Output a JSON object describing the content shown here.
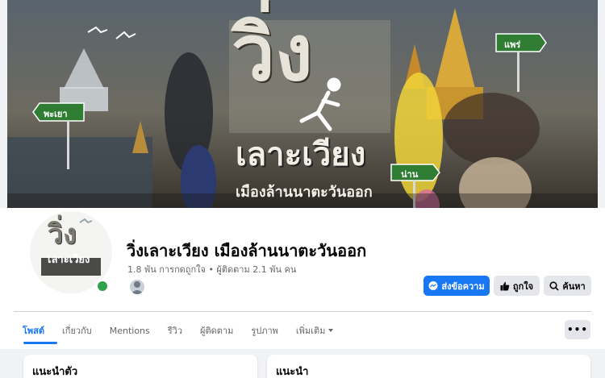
{
  "page": {
    "name": "วิ่งเลาะเวียง เมืองล้านนาตะวันออก",
    "stats": "1.8 พัน การกดถูกใจ • ผู้ติดตาม 2.1 พัน คน"
  },
  "cover": {
    "title_big": "วิ่ง",
    "title_line2": "เลาะเวียง",
    "title_line3": "เมืองล้านนาตะวันออก",
    "sign_left": "พะเยา",
    "sign_right_top": "แพร่",
    "sign_right_bottom": "น่าน"
  },
  "avatar": {
    "logo_line1": "วิ่ง",
    "logo_line2": "เลาะเวียง"
  },
  "actions": {
    "message": "ส่งข้อความ",
    "like": "ถูกใจ",
    "search": "ค้นหา"
  },
  "tabs": [
    {
      "label": "โพสต์"
    },
    {
      "label": "เกี่ยวกับ"
    },
    {
      "label": "Mentions"
    },
    {
      "label": "รีวิว"
    },
    {
      "label": "ผู้ติดตาม"
    },
    {
      "label": "รูปภาพ"
    },
    {
      "label": "เพิ่มเติม"
    }
  ],
  "more_menu": "•••",
  "cards": {
    "intro_title": "แนะนำตัว",
    "recommend_title": "แนะนำ"
  },
  "colors": {
    "accent": "#1877f2",
    "online": "#31a24c",
    "sign_green": "#2e7d32"
  }
}
